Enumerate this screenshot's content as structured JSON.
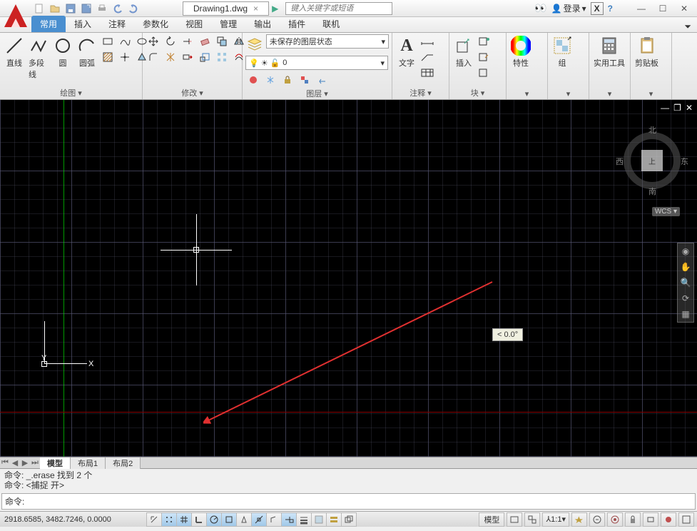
{
  "title_bar": {
    "file_name": "Drawing1.dwg",
    "search_placeholder": "键入关键字或短语",
    "login_label": "登录"
  },
  "ribbon_tabs": [
    "常用",
    "插入",
    "注释",
    "参数化",
    "视图",
    "管理",
    "输出",
    "插件",
    "联机"
  ],
  "active_tab": "常用",
  "panels": {
    "draw": {
      "title": "绘图 ▾",
      "line": "直线",
      "polyline": "多段线",
      "circle": "圆",
      "arc": "圆弧"
    },
    "modify": {
      "title": "修改 ▾"
    },
    "layer": {
      "title": "图层 ▾",
      "state": "未保存的图层状态"
    },
    "annotate": {
      "title": "注释 ▾",
      "text": "文字"
    },
    "block": {
      "title": "块 ▾",
      "insert": "插入"
    },
    "props": {
      "title": "特性 ▾",
      "label": "特性"
    },
    "group": {
      "title": "组 ▾",
      "label": "组"
    },
    "utils": {
      "title": "实用工具 ▾",
      "label": "实用工具"
    },
    "clip": {
      "title": "剪贴板 ▾",
      "label": "剪贴板"
    }
  },
  "viewcube": {
    "n": "北",
    "s": "南",
    "e": "东",
    "w": "西",
    "top": "上",
    "wcs": "WCS ▾"
  },
  "angle_tooltip": "< 0.0°",
  "ucs": {
    "x": "X",
    "y": "Y"
  },
  "model_tabs": {
    "model": "模型",
    "layout1": "布局1",
    "layout2": "布局2"
  },
  "command": {
    "hist1": "命令: _.erase 找到 2 个",
    "hist2": "命令: <捕捉 开>",
    "prompt": "命令:"
  },
  "status": {
    "coords": "2918.6585,  3482.7246,  0.0000",
    "model": "模型",
    "scale": "1:1"
  }
}
